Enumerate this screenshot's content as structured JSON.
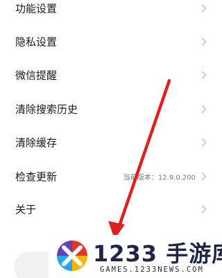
{
  "settings": {
    "items": [
      {
        "label": "功能设置",
        "value": ""
      },
      {
        "label": "隐私设置",
        "value": ""
      },
      {
        "label": "微信提醒",
        "value": ""
      },
      {
        "label": "清除搜索历史",
        "value": ""
      },
      {
        "label": "清除缓存",
        "value": ""
      },
      {
        "label": "检查更新",
        "value": "当前版本：12.9.0.200"
      },
      {
        "label": "关于",
        "value": ""
      }
    ]
  },
  "icons": {
    "chevron": "chevron-right-icon",
    "arrow": "red-arrow-annotation",
    "logo": "1233-logo-icon"
  },
  "colors": {
    "arrow": "#e02020",
    "text": "#1a1a1a",
    "chevron": "#bdbdbd",
    "brand": "#1f2545"
  },
  "watermark": {
    "brand": "1233 手游库",
    "site": "GAMES.1233NEWS.COM"
  }
}
